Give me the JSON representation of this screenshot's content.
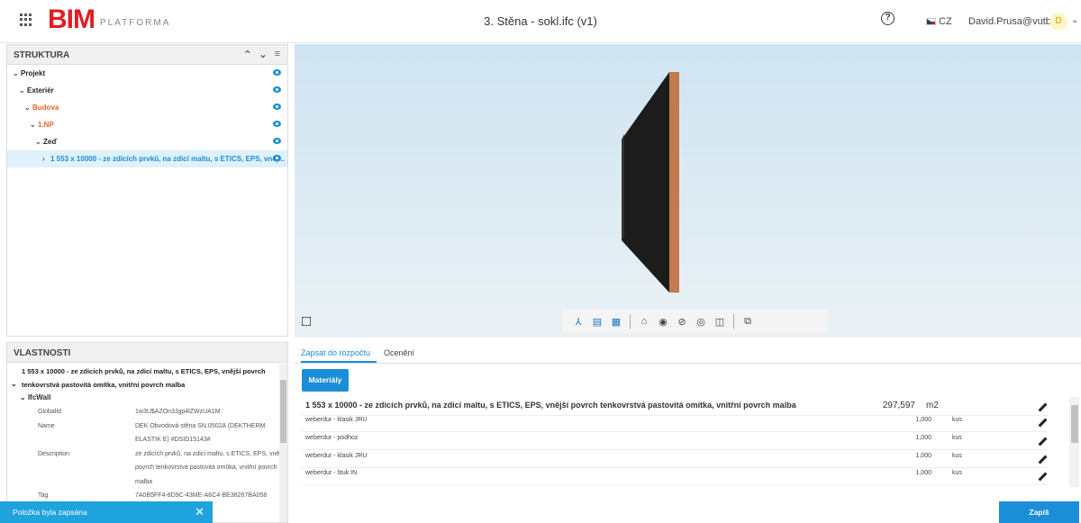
{
  "header": {
    "logo_main": "BIM",
    "logo_sub": "PLATFORMA",
    "title": "3. Stěna - sokl.ifc (v1)",
    "help_glyph": "?",
    "lang": "CZ",
    "user": "David.Prusa@vutbr.cz",
    "avatar": "D",
    "chevron": "⌄"
  },
  "structure": {
    "heading": "STRUKTURA",
    "items": [
      {
        "label": "Projekt",
        "chev": "⌄"
      },
      {
        "label": "Exteriér",
        "chev": "⌄"
      },
      {
        "label": "Budova",
        "chev": "⌄"
      },
      {
        "label": "1.NP",
        "chev": "⌄"
      },
      {
        "label": "Zeď",
        "chev": "⌄"
      },
      {
        "label": "1 553 x 10000 - ze zdicích prvků, na zdicí maltu, s ETICS, EPS, vněj...",
        "chev": "›"
      }
    ]
  },
  "viewer": {
    "toolbar_icons": [
      "axes-icon",
      "list-icon",
      "table-icon",
      "home-icon",
      "eye-icon",
      "hide-icon",
      "isolate-icon",
      "section-icon",
      "compare-icon"
    ]
  },
  "properties": {
    "heading": "VLASTNOSTI",
    "title": "1 553 x 10000 - ze zdicích prvků, na zdicí maltu, s ETICS, EPS, vnější povrch tenkovrstvá pastovitá omítka, vnitřní povrch malba",
    "section": "IfcWall",
    "rows": [
      {
        "key": "GlobalId",
        "value": "1w3U$AZOn3Jgp4lZWzUA1M"
      },
      {
        "key": "Name",
        "value": "DEK Obvodová stěna SN.0502A (DEKTHERM ELASTIK E) #DSID15143#"
      },
      {
        "key": "Description",
        "value": "ze zdicích prvků, na zdicí maltu, s ETICS, EPS, vnější povrch tenkovrstvá pastovitá omítka, vnitřní povrch malba"
      },
      {
        "key": "Tag",
        "value": "7A0B5FF4-8D9C-43ME-A6C4-BE38267BA056"
      }
    ]
  },
  "toast": {
    "text": "Položka byla zapsána",
    "close": "✕"
  },
  "budget": {
    "tab_write": "Zapsat do rozpočtu",
    "tab_price": "Ocenění",
    "materials_btn": "Materiály",
    "main_item": {
      "name": "1 553 x 10000 - ze zdicích prvků, na zdicí maltu, s ETICS, EPS, vnější povrch tenkovrstvá pastovitá omítka, vnitřní povrch malba",
      "qty": "297,597",
      "unit": "m2"
    },
    "items": [
      {
        "name": "weberdur - klasik JRU",
        "qty": "1,000",
        "unit": "kus"
      },
      {
        "name": "weberdur - podhoz",
        "qty": "1,000",
        "unit": "kus"
      },
      {
        "name": "weberdur - klasik JRU",
        "qty": "1,000",
        "unit": "kus"
      },
      {
        "name": "weberdur - štuk IN",
        "qty": "1,000",
        "unit": "kus"
      }
    ],
    "save_btn": "Zapiš"
  }
}
